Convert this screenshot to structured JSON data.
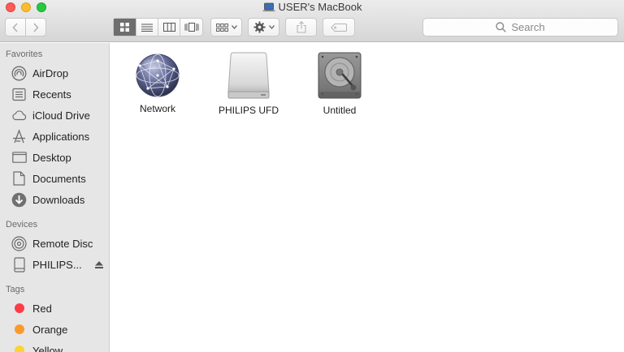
{
  "window": {
    "title": "USER's MacBook"
  },
  "toolbar": {
    "search_placeholder": "Search"
  },
  "sidebar": {
    "favorites_header": "Favorites",
    "favorites": [
      {
        "label": "AirDrop",
        "icon": "airdrop-icon"
      },
      {
        "label": "Recents",
        "icon": "recents-icon"
      },
      {
        "label": "iCloud Drive",
        "icon": "cloud-icon"
      },
      {
        "label": "Applications",
        "icon": "applications-icon"
      },
      {
        "label": "Desktop",
        "icon": "desktop-icon"
      },
      {
        "label": "Documents",
        "icon": "documents-icon"
      },
      {
        "label": "Downloads",
        "icon": "downloads-icon"
      }
    ],
    "devices_header": "Devices",
    "devices": [
      {
        "label": "Remote Disc",
        "icon": "disc-icon"
      },
      {
        "label": "PHILIPS...",
        "icon": "drive-icon"
      }
    ],
    "tags_header": "Tags",
    "tags": [
      {
        "label": "Red",
        "color": "#fc3d48"
      },
      {
        "label": "Orange",
        "color": "#f99a2b"
      },
      {
        "label": "Yellow",
        "color": "#fbd332"
      }
    ]
  },
  "files": [
    {
      "name": "Network",
      "icon": "network-globe-icon"
    },
    {
      "name": "PHILIPS UFD",
      "icon": "external-drive-icon"
    },
    {
      "name": "Untitled",
      "icon": "hard-disk-icon"
    }
  ]
}
